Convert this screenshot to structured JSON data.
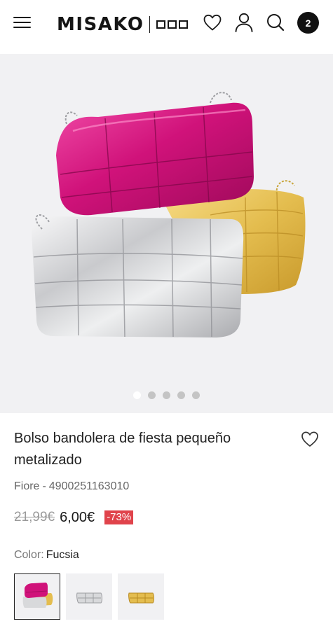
{
  "header": {
    "brand": "MISAKO",
    "cart_count": "2",
    "icons": [
      "menu-icon",
      "heart-icon",
      "user-icon",
      "search-icon",
      "cart-badge"
    ]
  },
  "gallery": {
    "image": "metallic quilted crossbody bags in fuchsia, silver and gold",
    "slide_count": 5,
    "active_slide": 1
  },
  "product": {
    "title": "Bolso bandolera de fiesta pequeño metalizado",
    "brand": "Fiore",
    "separator": "-",
    "reference": "4900251163010",
    "old_price": "21,99€",
    "price": "6,00€",
    "discount": "-73%",
    "color_label": "Color:",
    "color_value": "Fucsia"
  },
  "swatches": [
    {
      "name": "fucsia",
      "selected": true
    },
    {
      "name": "plata",
      "selected": false
    },
    {
      "name": "oro",
      "selected": false
    }
  ],
  "colors": {
    "fuchsia": "#d0127a",
    "silver": "#d8d9db",
    "gold": "#e4bd4f",
    "discount": "#e0434b",
    "gallery_bg": "#f1f1f3"
  }
}
